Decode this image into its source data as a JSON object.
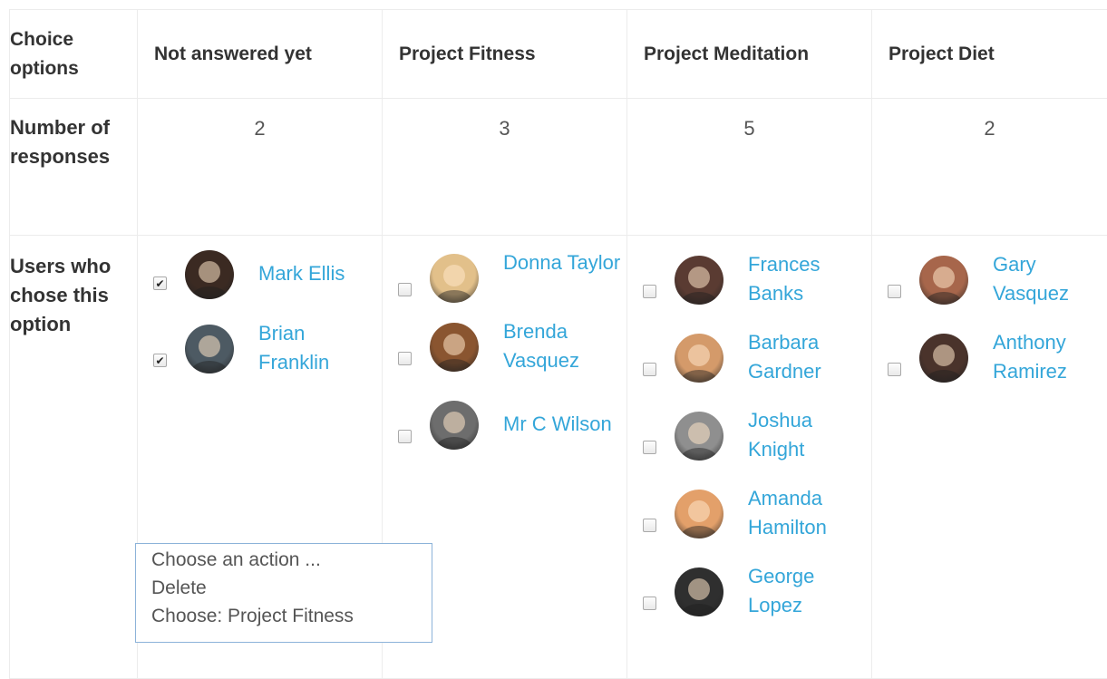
{
  "table": {
    "corner_header": "Choice options",
    "columns": [
      "Not answered yet",
      "Project Fitness",
      "Project Meditation",
      "Project Diet"
    ],
    "row_labels": {
      "responses": "Number of responses",
      "users": "Users who chose this option"
    },
    "counts": [
      "2",
      "3",
      "5",
      "2"
    ]
  },
  "users": {
    "not_answered": [
      {
        "name": "Mark Ellis",
        "checked": true,
        "avatar_color": "#3b2a22"
      },
      {
        "name": "Brian Franklin",
        "checked": true,
        "avatar_color": "#4d5a63"
      }
    ],
    "fitness": [
      {
        "name": "Donna Taylor",
        "checked": false,
        "avatar_color": "#e2c08a"
      },
      {
        "name": "Brenda Vasquez",
        "checked": false,
        "avatar_color": "#8a5530"
      },
      {
        "name": "Mr C Wilson",
        "checked": false,
        "avatar_color": "#6d6d6d"
      }
    ],
    "meditation": [
      {
        "name": "Frances Banks",
        "checked": false,
        "avatar_color": "#5a3b32"
      },
      {
        "name": "Barbara Gardner",
        "checked": false,
        "avatar_color": "#d49a6a"
      },
      {
        "name": "Joshua Knight",
        "checked": false,
        "avatar_color": "#8f8f8f"
      },
      {
        "name": "Amanda Hamilton",
        "checked": false,
        "avatar_color": "#e3a06a"
      },
      {
        "name": "George Lopez",
        "checked": false,
        "avatar_color": "#2f2f2f"
      }
    ],
    "diet": [
      {
        "name": "Gary Vasquez",
        "checked": false,
        "avatar_color": "#a7664b"
      },
      {
        "name": "Anthony Ramirez",
        "checked": false,
        "avatar_color": "#4a332b"
      }
    ]
  },
  "action_select": {
    "options": [
      "Choose an action ...",
      "Delete",
      "Choose: Project Fitness"
    ]
  },
  "colors": {
    "link": "#34a6d9",
    "border": "#ececec",
    "select_border": "#8cb3d9"
  }
}
